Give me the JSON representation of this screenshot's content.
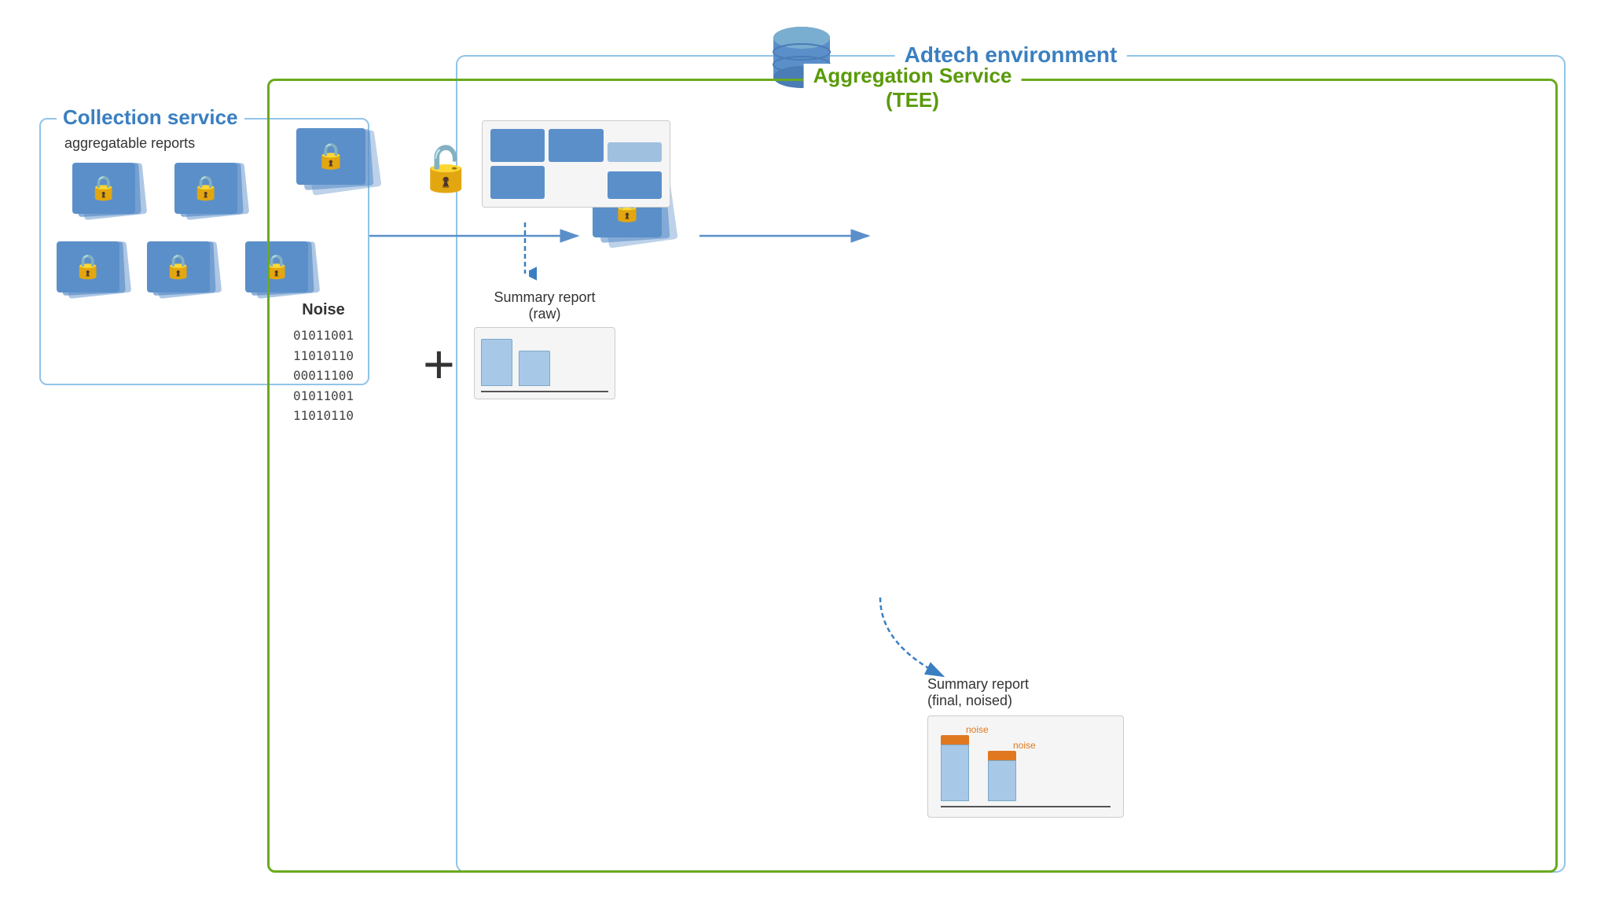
{
  "adtech": {
    "label": "Adtech environment"
  },
  "collection": {
    "label": "Collection service",
    "sublabel": "aggregatable reports",
    "reports_count": 5
  },
  "aggregation": {
    "label": "Aggregation Service",
    "label2": "(TEE)"
  },
  "noise": {
    "label": "Noise",
    "binary": [
      "01011001",
      "11010110",
      "00011100",
      "01011001",
      "11010110"
    ]
  },
  "summary_raw": {
    "label": "Summary report",
    "sublabel": "(raw)"
  },
  "summary_final": {
    "label": "Summary report",
    "sublabel": "(final, noised)"
  },
  "noise_labels": [
    "noise",
    "noise"
  ],
  "plus_sign": "+",
  "lock_emoji": "🔒",
  "unlock_emoji": "🔓"
}
